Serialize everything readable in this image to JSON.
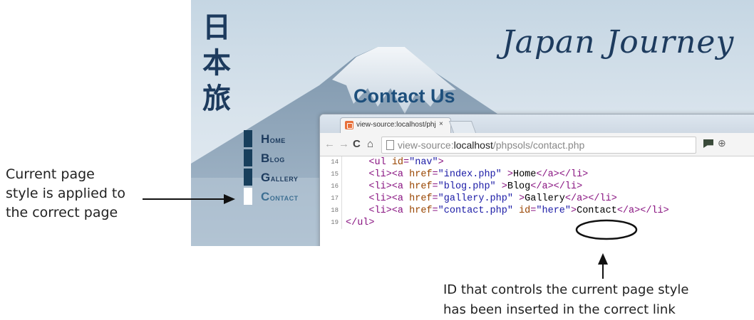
{
  "annotations": {
    "left": [
      "Current page",
      "style is applied to",
      "the correct page"
    ],
    "bottom": [
      "ID that controls the current page style",
      "has been inserted in the correct link"
    ]
  },
  "site": {
    "kanji": [
      "日",
      "本",
      "旅"
    ],
    "title": "Japan Journey",
    "page_heading": "Contact Us",
    "nav": [
      {
        "label": "Home",
        "current": false
      },
      {
        "label": "Blog",
        "current": false
      },
      {
        "label": "Gallery",
        "current": false
      },
      {
        "label": "Contact",
        "current": true
      }
    ]
  },
  "browser": {
    "tab_title": "view-source:localhost/phj",
    "tab_close": "×",
    "url_scheme": "view-source:",
    "url_host": "localhost",
    "url_path": "/phpsols/contact.php",
    "source_lines": [
      {
        "num": "14",
        "html": "    <ul id=\"nav\">"
      },
      {
        "num": "15",
        "html": "    <li><a href=\"index.php\" >Home</a></li>"
      },
      {
        "num": "16",
        "html": "    <li><a href=\"blog.php\" >Blog</a></li>"
      },
      {
        "num": "17",
        "html": "    <li><a href=\"gallery.php\" >Gallery</a></li>"
      },
      {
        "num": "18",
        "html": "    <li><a href=\"contact.php\" id=\"here\">Contact</a></li>"
      },
      {
        "num": "19",
        "html": "</ul>"
      }
    ]
  }
}
